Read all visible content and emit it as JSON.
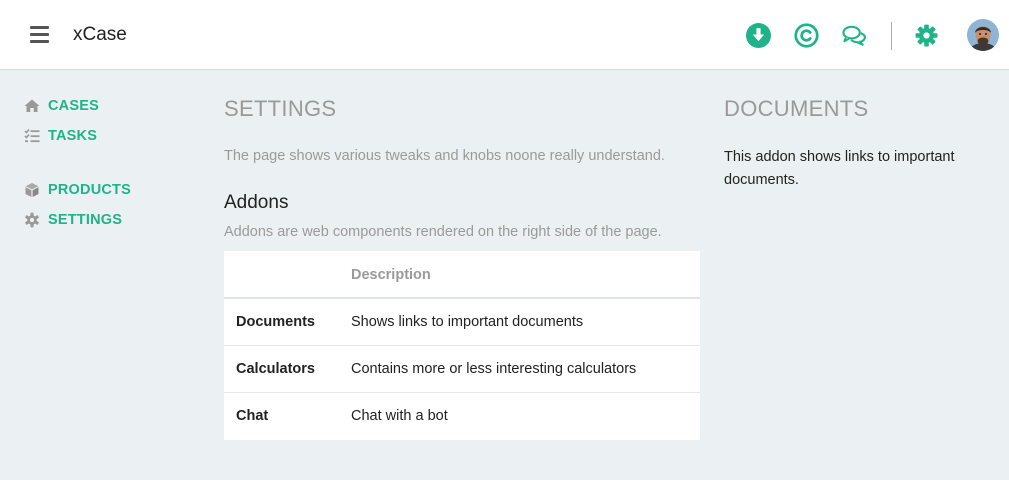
{
  "header": {
    "app_title": "xCase",
    "icons": [
      "menu-icon",
      "download-icon",
      "copyright-icon",
      "chat-icon",
      "gear-icon",
      "avatar"
    ],
    "accent_color": "#1fb38a"
  },
  "sidebar": {
    "items": [
      {
        "label": "CASES",
        "icon": "home-icon"
      },
      {
        "label": "TASKS",
        "icon": "tasks-icon"
      },
      {
        "label": "PRODUCTS",
        "icon": "cube-icon"
      },
      {
        "label": "SETTINGS",
        "icon": "gear-icon"
      }
    ]
  },
  "settings": {
    "title": "SETTINGS",
    "description": "The page shows various tweaks and knobs noone really understand.",
    "addons_heading": "Addons",
    "addons_description": "Addons are web components rendered on the right side of the page.",
    "table": {
      "columns": [
        "",
        "Description"
      ],
      "rows": [
        {
          "name": "Documents",
          "description": "Shows links to important documents"
        },
        {
          "name": "Calculators",
          "description": "Contains more or less interesting calculators"
        },
        {
          "name": "Chat",
          "description": "Chat with a bot"
        }
      ]
    }
  },
  "documents": {
    "title": "DOCUMENTS",
    "text": "This addon shows links to important documents."
  }
}
